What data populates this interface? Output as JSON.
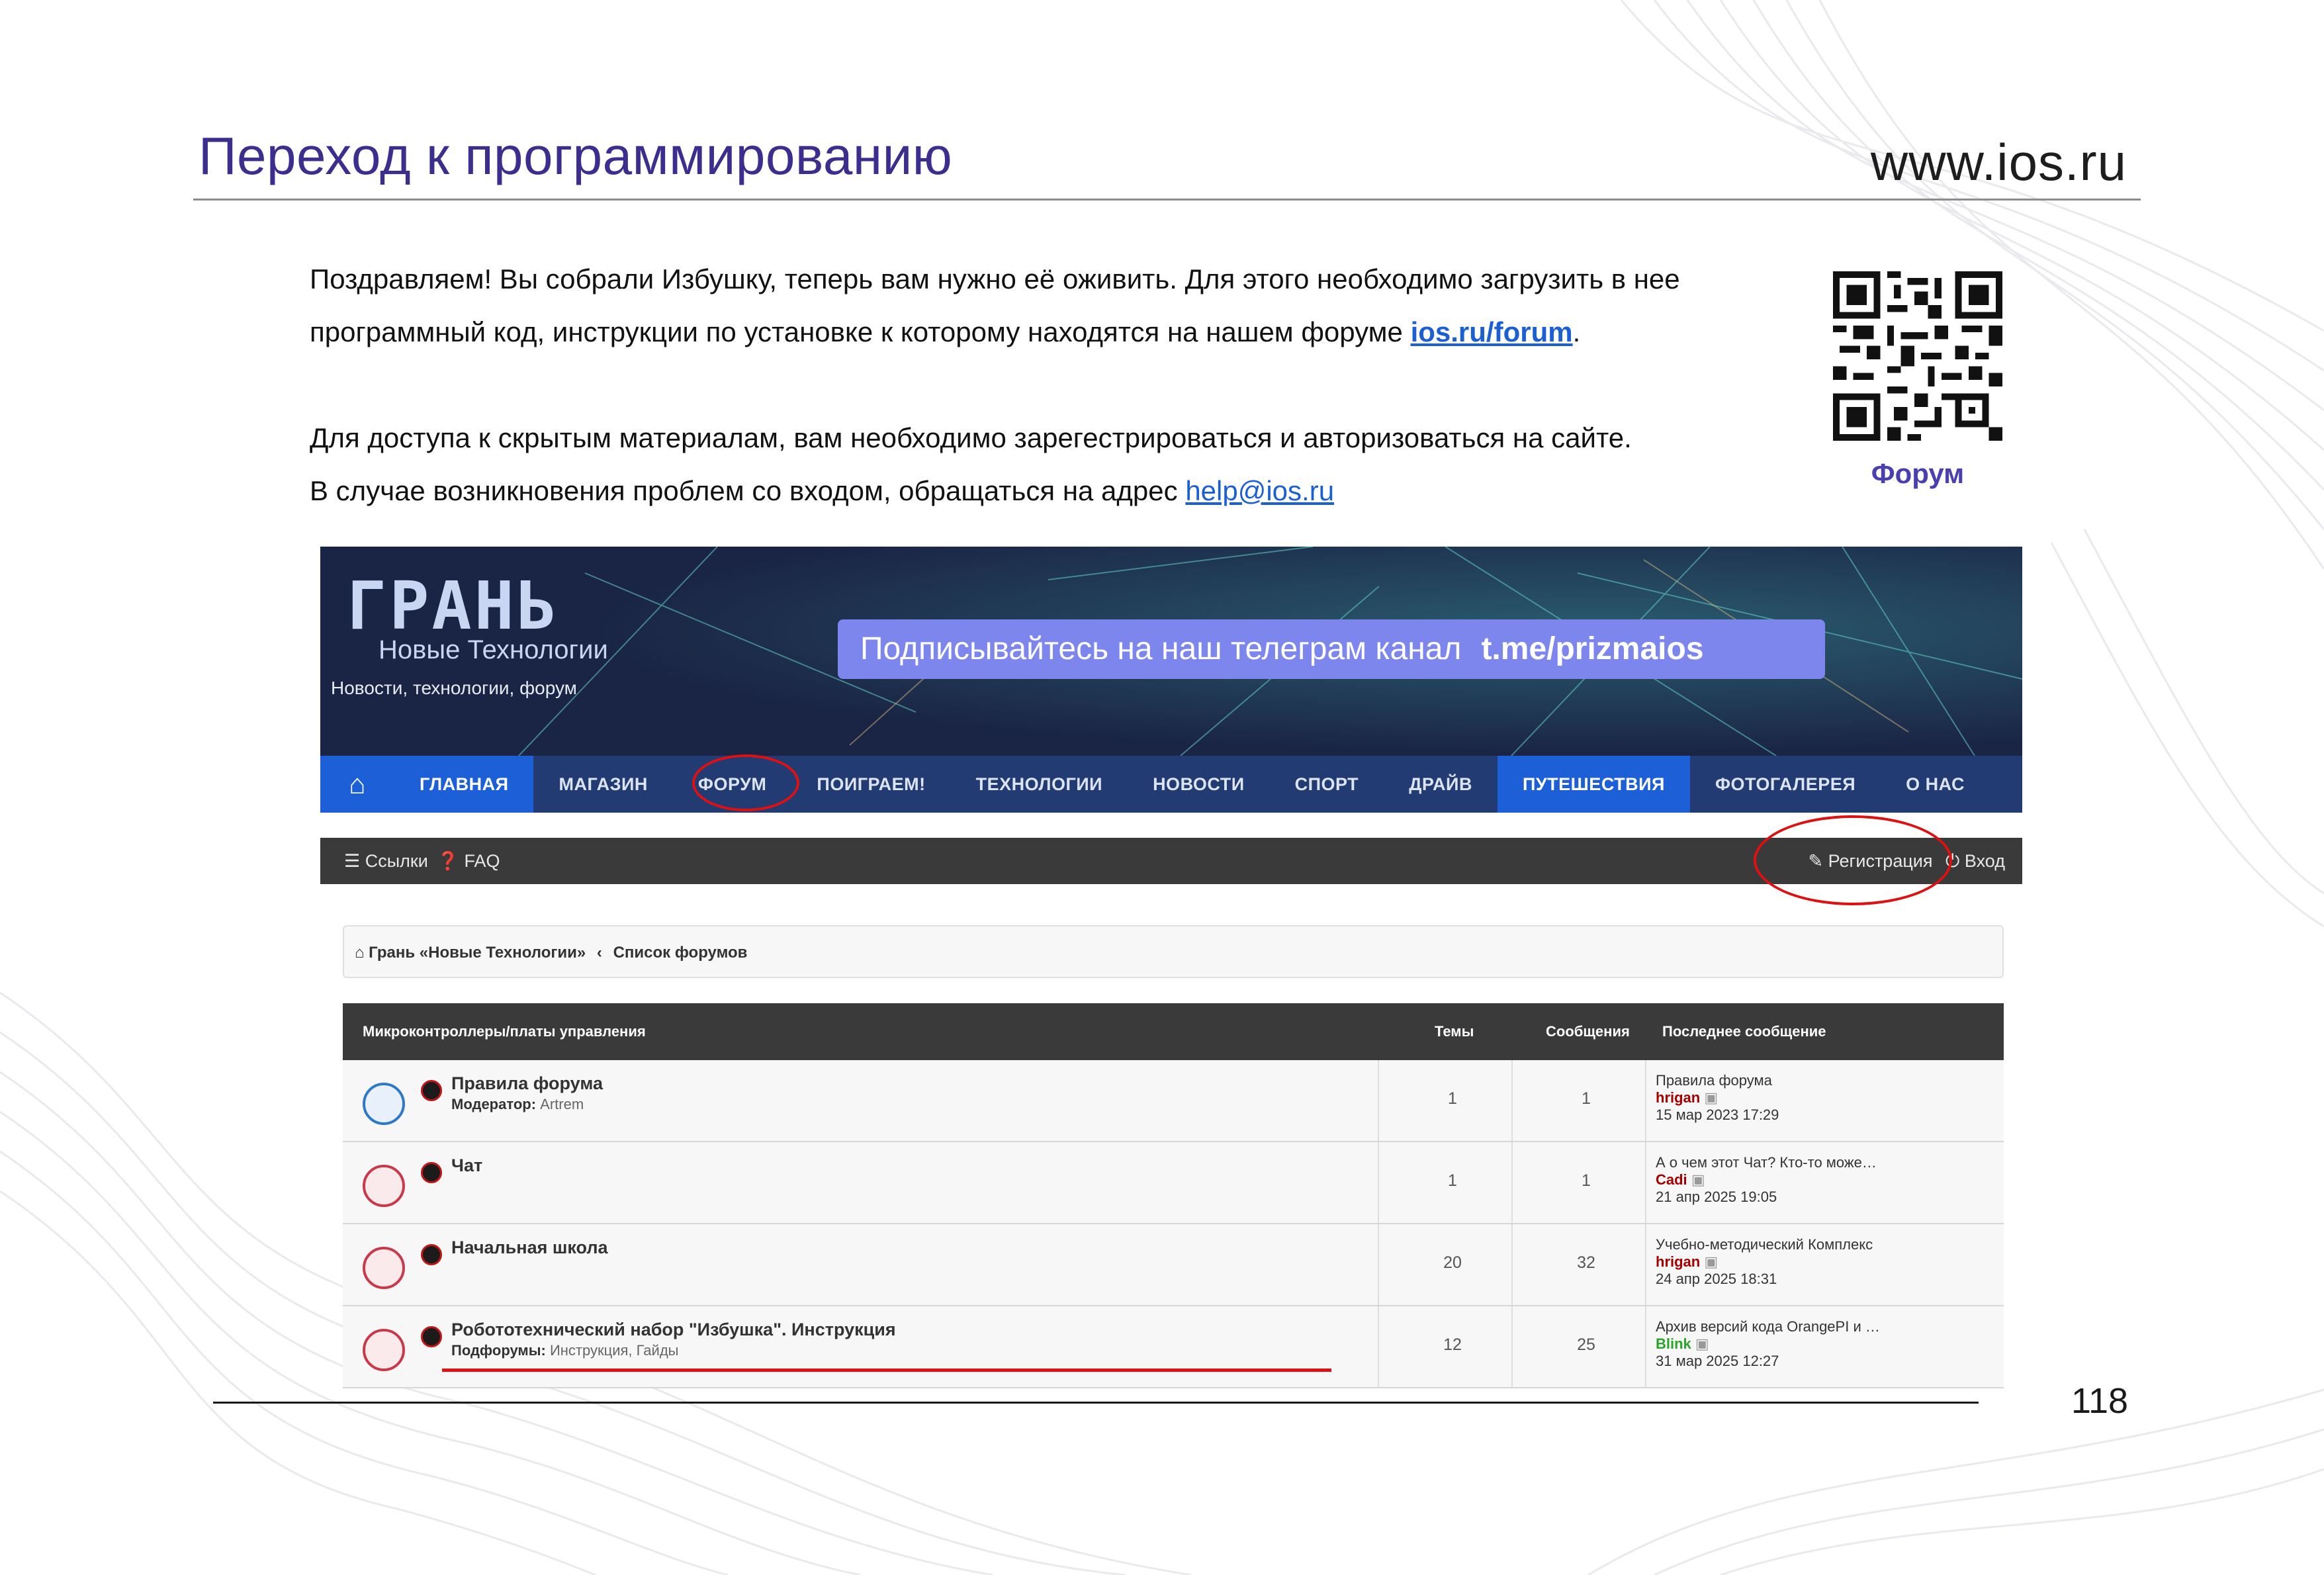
{
  "slide": {
    "title": "Переход к программированию",
    "site": "www.ios.ru",
    "page_number": "118"
  },
  "intro": {
    "line1": "Поздравляем! Вы собрали Избушку, теперь вам нужно её оживить. Для этого необходимо загрузить в нее",
    "line2_before": "программный код, инструкции по установке к которому находятся на нашем форуме ",
    "forum_link": "ios.ru/forum",
    "line2_after": ".",
    "line3": "Для доступа к скрытым материалам, вам необходимо зарегестрироваться и авторизоваться на сайте.",
    "line4_before": "В случае возникновения проблем со входом, обращаться на адрес ",
    "email_link": "help@ios.ru"
  },
  "qr": {
    "label": "Форум"
  },
  "forum": {
    "logo_name": "ГРАНЬ",
    "logo_sub": "Новые Технологии",
    "tagline": "Новости, технологии, форум",
    "telegram_text": "Подписывайтесь на наш телеграм канал",
    "telegram_handle": "t.me/prizmaios",
    "nav": [
      {
        "label": "ГЛАВНАЯ"
      },
      {
        "label": "МАГАЗИН"
      },
      {
        "label": "ФОРУМ"
      },
      {
        "label": "ПОИГРАЕМ!"
      },
      {
        "label": "ТЕХНОЛОГИИ"
      },
      {
        "label": "НОВОСТИ"
      },
      {
        "label": "СПОРТ"
      },
      {
        "label": "ДРАЙВ"
      },
      {
        "label": "ПУТЕШЕСТВИЯ"
      },
      {
        "label": "ФОТОГАЛЕРЕЯ"
      },
      {
        "label": "О НАС"
      }
    ],
    "toolbar": {
      "links": "Ссылки",
      "faq": "FAQ",
      "register": "Регистрация",
      "login": "Вход"
    },
    "breadcrumb": {
      "home": "Грань «Новые Технологии»",
      "sep": "‹",
      "current": "Список форумов"
    },
    "table": {
      "category": "Микроконтроллеры/платы управления",
      "col_topics": "Темы",
      "col_posts": "Сообщения",
      "col_last": "Последнее сообщение",
      "rows": [
        {
          "name": "Правила форума",
          "sub_label": "Модератор:",
          "sub_value": "Artrem",
          "topics": "1",
          "posts": "1",
          "last_title": "Правила форума",
          "last_user": "hrigan",
          "last_date": "15 мар 2023 17:29",
          "user_color": "#a50000",
          "icon_color": "#2f78c8"
        },
        {
          "name": "Чат",
          "sub_label": "",
          "sub_value": "",
          "topics": "1",
          "posts": "1",
          "last_title": "А о чем этот Чат? Кто-то може…",
          "last_user": "Cadi",
          "last_date": "21 апр 2025 19:05",
          "user_color": "#a50000",
          "icon_color": "#c83a4a"
        },
        {
          "name": "Начальная школа",
          "sub_label": "",
          "sub_value": "",
          "topics": "20",
          "posts": "32",
          "last_title": "Учебно-методический Комплекс",
          "last_user": "hrigan",
          "last_date": "24 апр 2025 18:31",
          "user_color": "#a50000",
          "icon_color": "#c83a4a"
        },
        {
          "name": "Робототехнический набор \"Избушка\". Инструкция",
          "sub_label": "Подфорумы:",
          "sub_value": "Инструкция, Гайды",
          "topics": "12",
          "posts": "25",
          "last_title": "Архив версий кода OrangePI и …",
          "last_user": "Blink",
          "last_date": "31 мар 2025 12:27",
          "user_color": "#2aa52a",
          "icon_color": "#c83a4a"
        }
      ]
    }
  }
}
